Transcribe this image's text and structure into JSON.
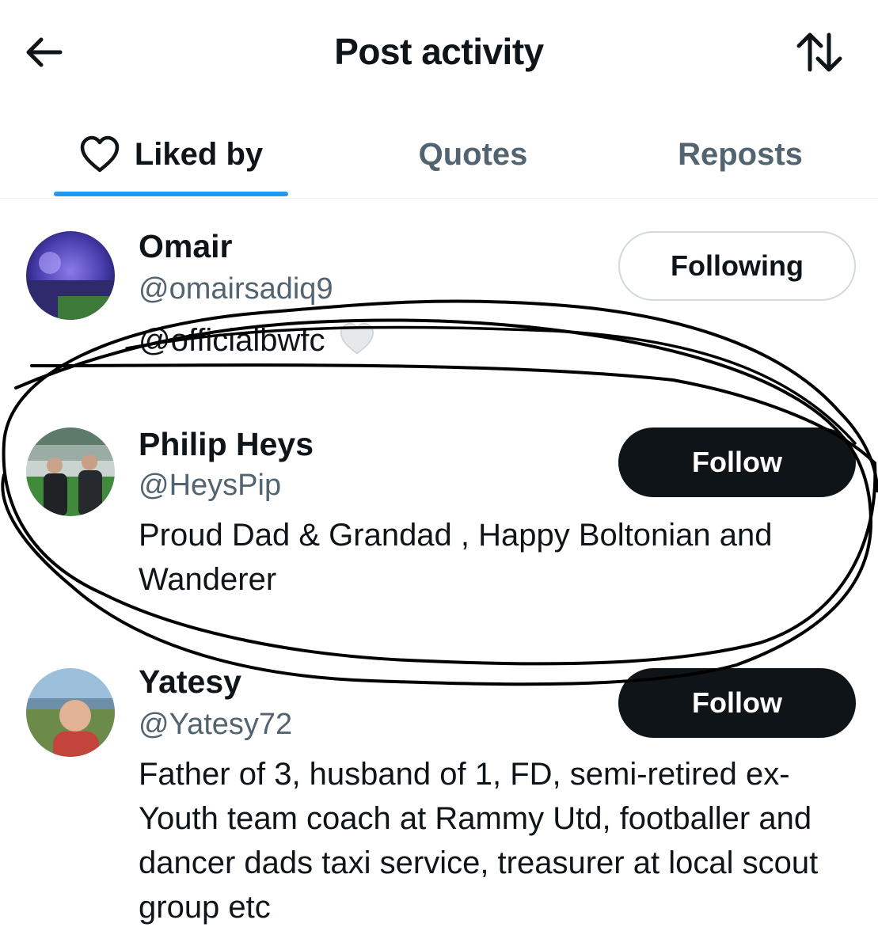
{
  "header": {
    "title": "Post activity",
    "back_icon": "arrow-left-icon",
    "sort_icon": "sort-arrows-icon"
  },
  "tabs": [
    {
      "label": "Liked by",
      "icon": "heart-outline-icon",
      "active": true
    },
    {
      "label": "Quotes",
      "active": false
    },
    {
      "label": "Reposts",
      "active": false
    }
  ],
  "colors": {
    "text_primary": "#0f1419",
    "text_secondary": "#536471",
    "tab_indicator": "#1d9bf0",
    "follow_button_bg": "#0f1419",
    "annotation_ink": "#000000"
  },
  "users": [
    {
      "name": "Omair",
      "handle": "@omairsadiq9",
      "bio": "@officialbwfc",
      "bio_emoji": "white-heart-icon",
      "button": "Following"
    },
    {
      "name": "Philip Heys",
      "handle": "@HeysPip",
      "bio": "Proud Dad & Grandad , Happy Boltonian and Wanderer",
      "button": "Follow"
    },
    {
      "name": "Yatesy",
      "handle": "@Yatesy72",
      "bio": "Father of 3, husband of 1, FD, semi-retired ex-Youth team coach at Rammy Utd, footballer and dancer dads taxi service, treasurer at local scout group etc",
      "button": "Follow"
    }
  ]
}
